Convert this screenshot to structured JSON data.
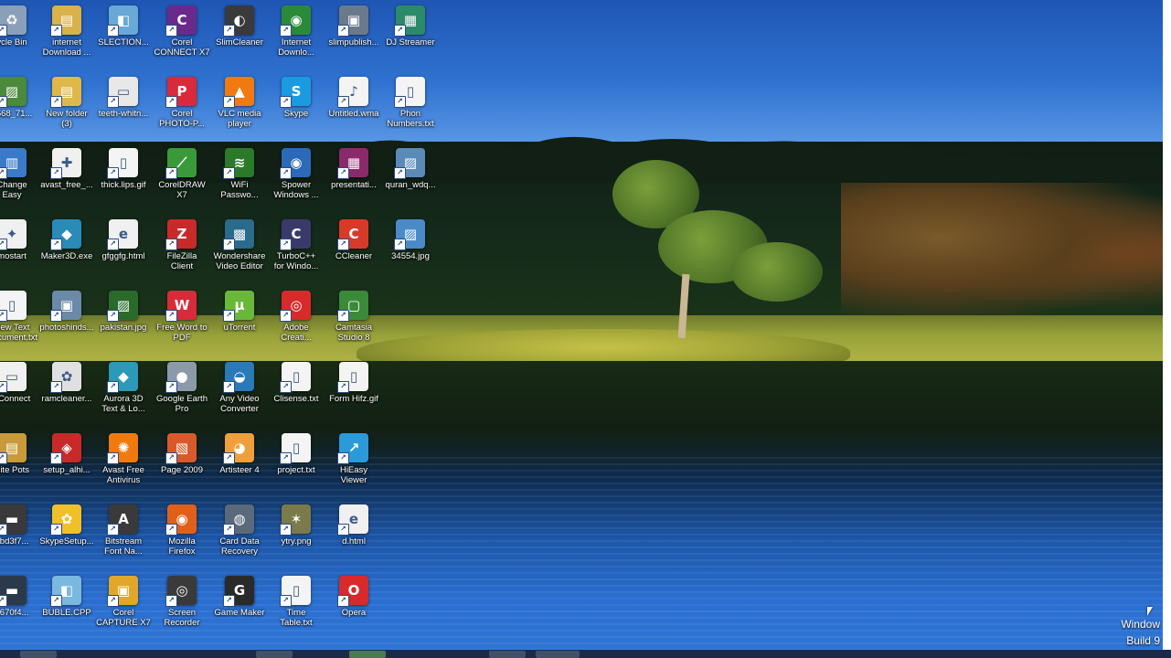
{
  "desktop": {
    "icons": [
      {
        "label": "ycle Bin",
        "color": "#8aa0b8",
        "glyph": "♻"
      },
      {
        "label": "internet\nDownload ...",
        "color": "#d9b24a",
        "glyph": "▤"
      },
      {
        "label": "SLECTION...",
        "color": "#6aa8d8",
        "glyph": "◧"
      },
      {
        "label": "Corel\nCONNECT X7",
        "color": "#6a2a8c",
        "glyph": "C"
      },
      {
        "label": "SlimCleaner",
        "color": "#3a3a3a",
        "glyph": "◐"
      },
      {
        "label": "Internet\nDownlo...",
        "color": "#2a8a3a",
        "glyph": "◉"
      },
      {
        "label": "slimpublish...",
        "color": "#6a7a8a",
        "glyph": "▣"
      },
      {
        "label": "DJ Streamer",
        "color": "#2a8a6a",
        "glyph": "▦"
      },
      {
        "label": "3668_71...",
        "color": "#4a8a3a",
        "glyph": "▨"
      },
      {
        "label": "New folder\n(3)",
        "color": "#e0b84a",
        "glyph": "▤"
      },
      {
        "label": "teeth-whitn...",
        "color": "#e8e8e8",
        "glyph": "▭"
      },
      {
        "label": "Corel\nPHOTO-P...",
        "color": "#d82a3a",
        "glyph": "P"
      },
      {
        "label": "VLC media\nplayer",
        "color": "#f07a10",
        "glyph": "▲"
      },
      {
        "label": "Skype",
        "color": "#1a9ae0",
        "glyph": "S"
      },
      {
        "label": "Untitled.wma",
        "color": "#f4f4f4",
        "glyph": "♪"
      },
      {
        "label": "Phon\nNumbers.txt",
        "color": "#f4f4f4",
        "glyph": "▯"
      },
      {
        "label": "Change\nEasy",
        "color": "#3a7ac8",
        "glyph": "▥"
      },
      {
        "label": "avast_free_...",
        "color": "#f0f0f0",
        "glyph": "✚"
      },
      {
        "label": "thick.lips.gif",
        "color": "#f4f4f4",
        "glyph": "▯"
      },
      {
        "label": "CorelDRAW\nX7",
        "color": "#3a9a3a",
        "glyph": "⟋"
      },
      {
        "label": "WiFi\nPasswo...",
        "color": "#2a7a2a",
        "glyph": "≋"
      },
      {
        "label": "Spower\nWindows ...",
        "color": "#2a6ab8",
        "glyph": "◉"
      },
      {
        "label": "presentati...",
        "color": "#8a2a6a",
        "glyph": "▦"
      },
      {
        "label": "quran_wdq...",
        "color": "#5a8ab8",
        "glyph": "▨"
      },
      {
        "label": "mostart",
        "color": "#f0f0f0",
        "glyph": "✦"
      },
      {
        "label": "Maker3D.exe",
        "color": "#2a8ab8",
        "glyph": "◆"
      },
      {
        "label": "gfggfg.html",
        "color": "#f0f0f0",
        "glyph": "e"
      },
      {
        "label": "FileZilla\nClient",
        "color": "#c82a2a",
        "glyph": "Z"
      },
      {
        "label": "Wondershare\nVideo Editor",
        "color": "#2a6a8a",
        "glyph": "▩"
      },
      {
        "label": "TurboC++\nfor Windo...",
        "color": "#3a3a6a",
        "glyph": "C"
      },
      {
        "label": "CCleaner",
        "color": "#d83a2a",
        "glyph": "C"
      },
      {
        "label": "34554.jpg",
        "color": "#4a8ac8",
        "glyph": "▨"
      },
      {
        "label": "New Text\nDocument.txt",
        "color": "#f4f4f4",
        "glyph": "▯"
      },
      {
        "label": "photoshinds...",
        "color": "#6a8aa8",
        "glyph": "▣"
      },
      {
        "label": "pakistan.jpg",
        "color": "#2a6a2a",
        "glyph": "▨"
      },
      {
        "label": "Free Word to\nPDF",
        "color": "#d82a3a",
        "glyph": "W"
      },
      {
        "label": "uTorrent",
        "color": "#6ab83a",
        "glyph": "µ"
      },
      {
        "label": "Adobe\nCreati...",
        "color": "#d82a2a",
        "glyph": "◎"
      },
      {
        "label": "Camtasia\nStudio 8",
        "color": "#3a8a3a",
        "glyph": "▢"
      },
      {
        "label": "oConnect",
        "color": "#f0f0f0",
        "glyph": "▭"
      },
      {
        "label": "ramcleaner...",
        "color": "#e0e0e0",
        "glyph": "✿"
      },
      {
        "label": "Aurora 3D\nText & Lo...",
        "color": "#2a9ab8",
        "glyph": "◆"
      },
      {
        "label": "Google Earth\nPro",
        "color": "#8a9aa8",
        "glyph": "●"
      },
      {
        "label": "Any Video\nConverter",
        "color": "#2a7ab8",
        "glyph": "◒"
      },
      {
        "label": "Clisense.txt",
        "color": "#f4f4f4",
        "glyph": "▯"
      },
      {
        "label": "Form Hifz.gif",
        "color": "#f4f4f4",
        "glyph": "▯"
      },
      {
        "label": "Site Pots",
        "color": "#c89a3a",
        "glyph": "▤"
      },
      {
        "label": "setup_alhi...",
        "color": "#c82a2a",
        "glyph": "◈"
      },
      {
        "label": "Avast Free\nAntivirus",
        "color": "#f07a10",
        "glyph": "✺"
      },
      {
        "label": "Page 2009",
        "color": "#d85a2a",
        "glyph": "▧"
      },
      {
        "label": "Artisteer 4",
        "color": "#f0a03a",
        "glyph": "◕"
      },
      {
        "label": "project.txt",
        "color": "#f4f4f4",
        "glyph": "▯"
      },
      {
        "label": "HiEasy\nViewer",
        "color": "#2a9ad8",
        "glyph": "↗"
      },
      {
        "label": "5bd3f7...",
        "color": "#3a3a3a",
        "glyph": "▬"
      },
      {
        "label": "SkypeSetup...",
        "color": "#f0c02a",
        "glyph": "✿"
      },
      {
        "label": "Bitstream\nFont Na...",
        "color": "#3a3a3a",
        "glyph": "A"
      },
      {
        "label": "Mozilla\nFirefox",
        "color": "#e0601a",
        "glyph": "◉"
      },
      {
        "label": "Card Data\nRecovery",
        "color": "#5a6a7a",
        "glyph": "◍"
      },
      {
        "label": "ytry.png",
        "color": "#7a7a4a",
        "glyph": "✶"
      },
      {
        "label": "d.html",
        "color": "#f0f0f0",
        "glyph": "e"
      },
      {
        "label": "0670f4...",
        "color": "#2a3a4a",
        "glyph": "▬"
      },
      {
        "label": "BUBLE.CPP",
        "color": "#7ab8e0",
        "glyph": "◧"
      },
      {
        "label": "Corel\nCAPTURE X7",
        "color": "#e0a82a",
        "glyph": "▣"
      },
      {
        "label": "Screen\nRecorder",
        "color": "#3a3a3a",
        "glyph": "◎"
      },
      {
        "label": "Game Maker",
        "color": "#2a2a2a",
        "glyph": "G"
      },
      {
        "label": "Time\nTable.txt",
        "color": "#f4f4f4",
        "glyph": "▯"
      },
      {
        "label": "Opera",
        "color": "#d82a2a",
        "glyph": "O"
      }
    ]
  },
  "watermark": {
    "line1": "Window",
    "line2": "Build 9"
  }
}
